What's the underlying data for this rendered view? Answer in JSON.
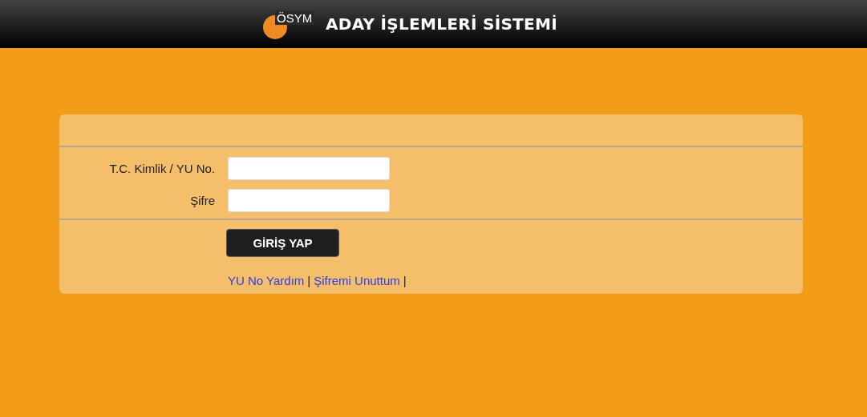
{
  "header": {
    "logo_text": "ÖSYM",
    "title": "ADAY İŞLEMLERİ SİSTEMİ"
  },
  "form": {
    "fields": [
      {
        "label": "T.C. Kimlik / YU No."
      },
      {
        "label": "Şifre"
      }
    ],
    "submit": "GİRİŞ YAP",
    "links": [
      {
        "label": "YU No Yardım",
        "separator": "|"
      },
      {
        "label": "Şifremi Unuttum",
        "separator": "|"
      }
    ]
  }
}
